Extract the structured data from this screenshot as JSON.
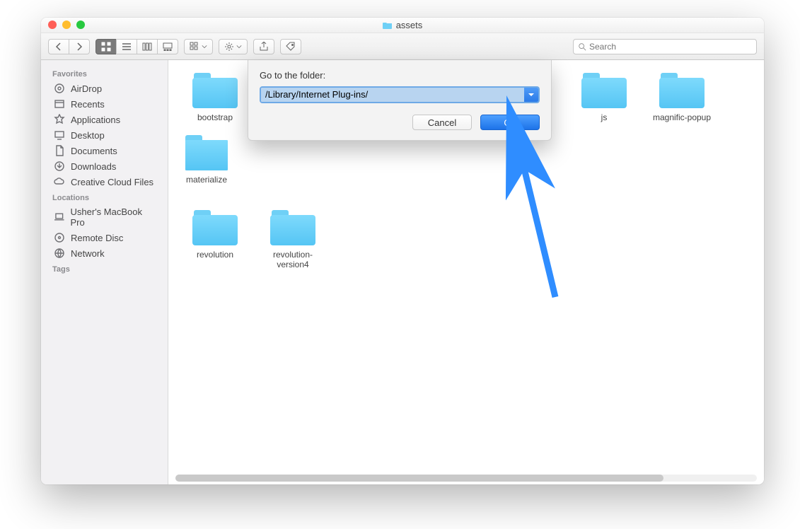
{
  "window": {
    "title": "assets"
  },
  "toolbar": {
    "search_placeholder": "Search"
  },
  "sidebar": {
    "sections": [
      {
        "header": "Favorites",
        "items": [
          {
            "icon": "airdrop",
            "label": "AirDrop"
          },
          {
            "icon": "recents",
            "label": "Recents"
          },
          {
            "icon": "apps",
            "label": "Applications"
          },
          {
            "icon": "desktop",
            "label": "Desktop"
          },
          {
            "icon": "documents",
            "label": "Documents"
          },
          {
            "icon": "downloads",
            "label": "Downloads"
          },
          {
            "icon": "cloud",
            "label": "Creative Cloud Files"
          }
        ]
      },
      {
        "header": "Locations",
        "items": [
          {
            "icon": "laptop",
            "label": "Usher's MacBook Pro"
          },
          {
            "icon": "disc",
            "label": "Remote Disc"
          },
          {
            "icon": "network",
            "label": "Network"
          }
        ]
      },
      {
        "header": "Tags",
        "items": []
      }
    ]
  },
  "content": {
    "folders": [
      "bootstrap",
      "js",
      "magnific-popup",
      "materialize",
      "revolution",
      "revolution-version4"
    ]
  },
  "dialog": {
    "label": "Go to the folder:",
    "value": "/Library/Internet Plug-ins/",
    "cancel": "Cancel",
    "go": "Go"
  }
}
